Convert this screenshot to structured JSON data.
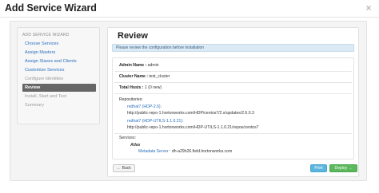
{
  "dialog": {
    "title": "Add Service Wizard",
    "close_label": "×"
  },
  "sidebar": {
    "header": "ADD SERVICE WIZARD",
    "items": [
      {
        "label": "Choose Services",
        "state": "done"
      },
      {
        "label": "Assign Masters",
        "state": "done"
      },
      {
        "label": "Assign Slaves and Clients",
        "state": "done"
      },
      {
        "label": "Customize Services",
        "state": "done"
      },
      {
        "label": "Configure Identities",
        "state": "pending"
      },
      {
        "label": "Review",
        "state": "active"
      },
      {
        "label": "Install, Start and Test",
        "state": "pending"
      },
      {
        "label": "Summary",
        "state": "pending"
      }
    ]
  },
  "main": {
    "title": "Review",
    "alert": "Please review the configuration before installation",
    "admin": {
      "label": "Admin Name :",
      "value": "admin"
    },
    "cluster": {
      "label": "Cluster Name :",
      "value": "test_cluster"
    },
    "hosts": {
      "label": "Total Hosts :",
      "value": "1 (0 new)"
    },
    "repos_label": "Repositories:",
    "repos": [
      {
        "name": "redhat7 (HDP-2.6):",
        "url": "http://public-repo-1.hortonworks.com/HDP/centos7/2.x/updates/2.6.0.3"
      },
      {
        "name": "redhat7 (HDP-UTILS-1.1.0.21):",
        "url": "http://public-repo-1.hortonworks.com/HDP-UTILS-1.1.0.21/repos/centos7"
      }
    ],
    "services_label": "Services:",
    "service": {
      "name": "Atlas",
      "component_label": "Metadata Server",
      "component_host": ": dh-a29h26.field.hortonworks.com"
    }
  },
  "footer": {
    "back_label": "← Back",
    "print_label": "Print",
    "deploy_label": "Deploy →"
  },
  "colors": {
    "link": "#2a6fbf",
    "active_nav": "#666666",
    "alert_bg": "#dbeaf5",
    "print_btn": "#5bb6de",
    "deploy_btn": "#5cb85c"
  }
}
